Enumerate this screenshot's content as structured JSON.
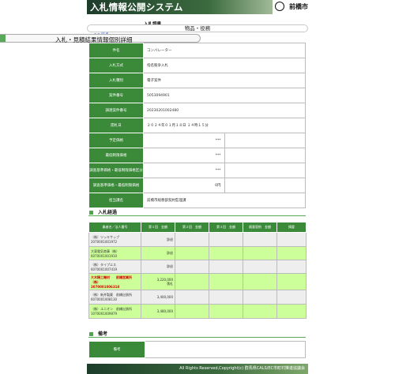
{
  "header": {
    "title": "入札情報公開システム",
    "city": "前橋市"
  },
  "breadcrumb": "入札調書",
  "category": "物品・役務",
  "back_link": "<< 戻る",
  "page_title": "入札・見積結果情報個別詳細",
  "detail": {
    "rows": [
      {
        "label": "件名",
        "value": "コンバレーター"
      },
      {
        "label": "入札方式",
        "value": "指名競争入札"
      },
      {
        "label": "入札種別",
        "value": "電子案件"
      },
      {
        "label": "案件番号",
        "value": "5053094901"
      },
      {
        "label": "調達案件番号",
        "value": "20230201002480"
      },
      {
        "label": "開札日",
        "value": "２０２４年０１月１８日 １４時１５分"
      }
    ],
    "price_rows": [
      {
        "label": "予定価格",
        "value": "***"
      },
      {
        "label": "最低制限価格",
        "value": "***"
      },
      {
        "label": "調査基準価格・最低制限価格区分",
        "value": "***"
      },
      {
        "label": "調査基準価格・最低制限価格",
        "value": "0円"
      }
    ],
    "dept": {
      "label": "担当課名",
      "value": "前橋市総務部契約監理課"
    }
  },
  "bids_section_title": "入札経過",
  "bids": {
    "headers": [
      "業者名／法人番号",
      "第１回　金額",
      "第２回　金額",
      "第３回　金額",
      "随意契約　金額",
      "摘要"
    ],
    "rows": [
      {
        "name": "（株）ツッキサップ",
        "number": "2070001001972",
        "first": "辞退",
        "note": "",
        "style": "grey",
        "win": false
      },
      {
        "name": "大東電気商事（株）",
        "number": "6070001001910",
        "first": "辞退",
        "note": "",
        "style": "green",
        "win": false
      },
      {
        "name": "（株）タイプエス",
        "number": "6070001007419",
        "first": "辞退",
        "note": "",
        "style": "grey",
        "win": false
      },
      {
        "name": "大木精工機材　　前橋営業所（株）",
        "number": "2070001006318",
        "first": "3,220,000",
        "note": "落札",
        "style": "green",
        "win": true
      },
      {
        "name": "（株）新井製薬　前橋出張所",
        "number": "6070001008130",
        "first": "3,400,000",
        "note": "",
        "style": "grey",
        "win": false
      },
      {
        "name": "（株）ユニオン　前橋出張所",
        "number": "1070001009879",
        "first": "3,480,000",
        "note": "",
        "style": "green",
        "win": false
      }
    ]
  },
  "remarks_section_title": "備考",
  "remarks": {
    "label": "備考",
    "value": ""
  },
  "footer": "All Rights Reserved,Copyright(c) 群馬県CALS/EC市町村推進協議会",
  "colors": {
    "header_green": "#3c6b3f",
    "table_header": "#3a8a3a",
    "row_green": "#ccff99",
    "row_grey": "#eeeeee",
    "winner_red": "#e00000"
  }
}
